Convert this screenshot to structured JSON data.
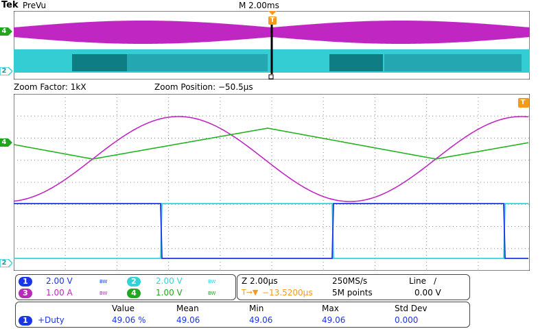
{
  "header": {
    "brand": "Tek",
    "mode": "PreVu",
    "timebase": "M 2.00ms",
    "trigger_marker": "T"
  },
  "zoom_bar": {
    "factor": "Zoom Factor: 1kX",
    "position": "Zoom Position: −50.5µs"
  },
  "ground_markers": {
    "ch4": "4",
    "ch2": "2",
    "trigger": "T"
  },
  "channels_panel": {
    "ch1": {
      "num": "1",
      "scale": "2.00 V",
      "bw": "BW"
    },
    "ch2": {
      "num": "2",
      "scale": "2.00 V",
      "bw": "BW"
    },
    "ch3": {
      "num": "3",
      "scale": "1.00 A",
      "bw": "BW"
    },
    "ch4": {
      "num": "4",
      "scale": "1.00 V",
      "bw": "BW"
    }
  },
  "timing_panel": {
    "zoom_scale": "Z 2.00µs",
    "sample_rate": "250MS/s",
    "trigger_source": "Line",
    "trigger_slope": "∕",
    "trigger_offset": "−13.5200µs",
    "trigger_icon": "T→▼",
    "record_length": "5M points",
    "trigger_level": "0.00 V"
  },
  "measurements": {
    "headers": [
      "Value",
      "Mean",
      "Min",
      "Max",
      "Std Dev"
    ],
    "rows": [
      {
        "channel": "1",
        "name": "+Duty",
        "value": "49.06 %",
        "mean": "49.06",
        "min": "49.06",
        "max": "49.06",
        "std_dev": "0.000"
      }
    ]
  },
  "colors": {
    "ch1": "#1a35e6",
    "ch2": "#34d2d8",
    "ch3": "#b42db4",
    "ch4": "#22a51f",
    "trigger": "#f39a1c"
  }
}
